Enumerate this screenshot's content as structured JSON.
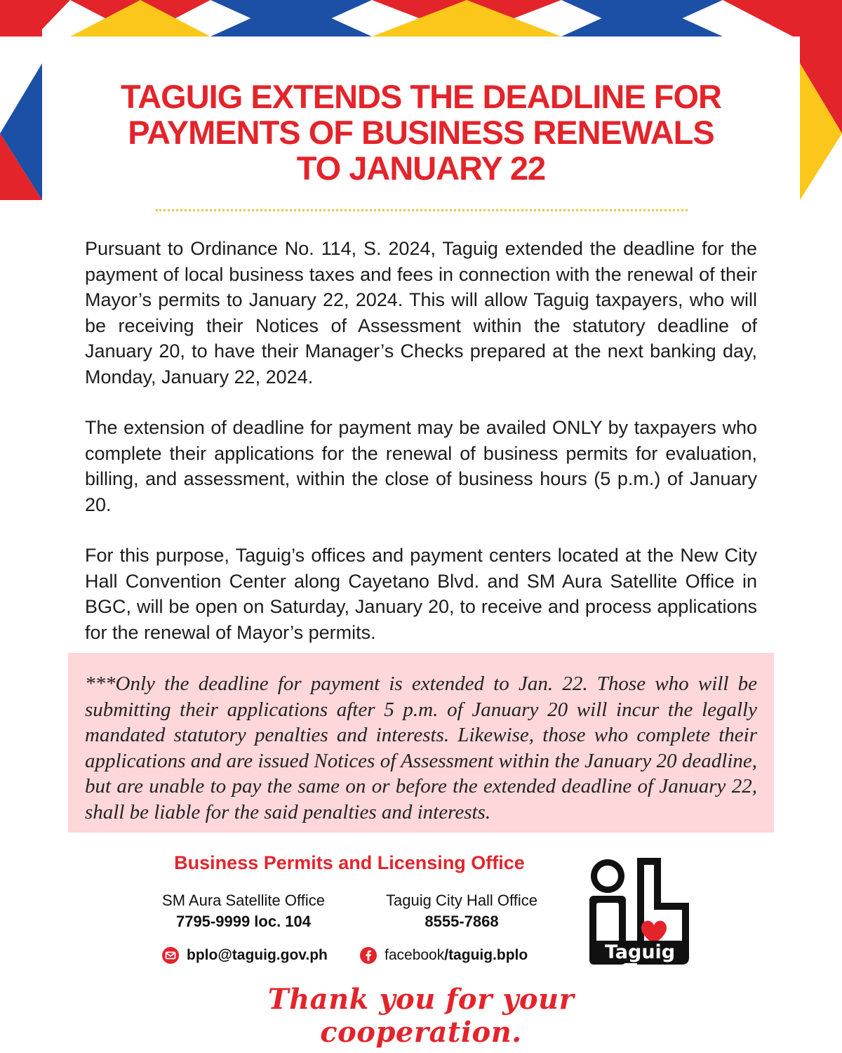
{
  "colors": {
    "red": "#e3242b",
    "yellow": "#fbc71a",
    "blue": "#1c4fa6",
    "pink_box": "#fdd7da"
  },
  "title": {
    "lines": [
      "TAGUIG EXTENDS THE DEADLINE  FOR",
      "PAYMENTS OF BUSINESS  RENEWALS",
      "TO JANUARY 22"
    ]
  },
  "paragraphs": [
    "Pursuant to Ordinance No. 114, S. 2024, Taguig extended the deadline for the payment of local business taxes and fees in connection with the renewal of their Mayor’s permits to January 22, 2024. This will allow Taguig taxpayers, who will be receiving their Notices of Assessment within the statutory deadline of January 20, to have their Manager’s Checks prepared at the next banking day, Monday, January 22, 2024.",
    "The extension of deadline for payment may be availed ONLY by taxpayers who complete their applications for the renewal of business permits for evaluation, billing, and assessment, within the close of business hours (5 p.m.) of January 20.",
    "For this purpose, Taguig’s offices and payment centers located at the New City Hall Convention Center along Cayetano Blvd. and SM Aura Satellite Office in BGC, will be open on Saturday, January 20, to receive and process applications for the renewal of Mayor’s permits."
  ],
  "notice": "***Only the deadline for payment is extended to Jan. 22. Those who will be submitting their applications after 5 p.m. of January 20 will incur the legally mandated statutory penalties and interests. Likewise, those who complete their applications and are issued Notices of Assessment within the January 20 deadline, but are unable to pay the same on or before the extended deadline of January 22, shall be liable for the said penalties and interests.",
  "footer": {
    "office_name": "Business Permits and Licensing Office",
    "contacts": [
      {
        "name": "SM Aura Satellite Office",
        "number": "7795-9999 loc. 104"
      },
      {
        "name": "Taguig City Hall Office",
        "number": "8555-7868"
      }
    ],
    "email": "bplo@taguig.gov.ph",
    "facebook_prefix": "facebook",
    "facebook_handle": "/taguig.bplo",
    "email_icon": "mail-icon",
    "facebook_icon": "facebook-icon",
    "logo_text": "Taguig",
    "thanks": "Thank you for your cooperation."
  }
}
